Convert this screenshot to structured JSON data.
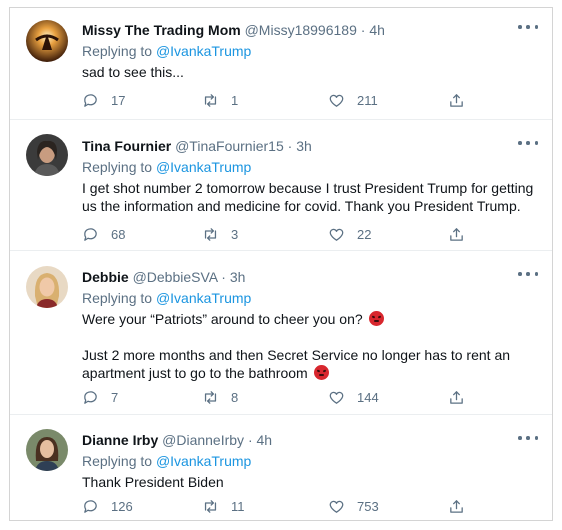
{
  "replying_label": "Replying to",
  "tweets": [
    {
      "name": "Missy The Trading Mom",
      "handle": "@Missy18996189",
      "separator": "·",
      "time": "4h",
      "mention": "@IvankaTrump",
      "paragraphs": [
        "sad to see this..."
      ],
      "replies": "17",
      "retweets": "1",
      "likes": "211",
      "avatar_color": "#6a3a1a"
    },
    {
      "name": "Tina Fournier",
      "handle": "@TinaFournier15",
      "separator": "·",
      "time": "3h",
      "mention": "@IvankaTrump",
      "paragraphs": [
        "I get shot number 2 tomorrow because I trust President Trump for getting us the information and medicine for covid.  Thank you President Trump."
      ],
      "replies": "68",
      "retweets": "3",
      "likes": "22",
      "avatar_color": "#4a4a4a"
    },
    {
      "name": "Debbie",
      "handle": "@DebbieSVA",
      "separator": "·",
      "time": "3h",
      "mention": "@IvankaTrump",
      "paragraphs": [
        "Were your “Patriots” around to cheer you on?",
        "Just 2 more months and then Secret Service no longer has to rent an apartment just to go to the bathroom"
      ],
      "replies": "7",
      "retweets": "8",
      "likes": "144",
      "avatar_color": "#c9a27a"
    },
    {
      "name": "Dianne Irby",
      "handle": "@DianneIrby",
      "separator": "·",
      "time": "4h",
      "mention": "@IvankaTrump",
      "paragraphs": [
        "Thank President Biden"
      ],
      "replies": "126",
      "retweets": "11",
      "likes": "753",
      "avatar_color": "#5a4636"
    }
  ]
}
